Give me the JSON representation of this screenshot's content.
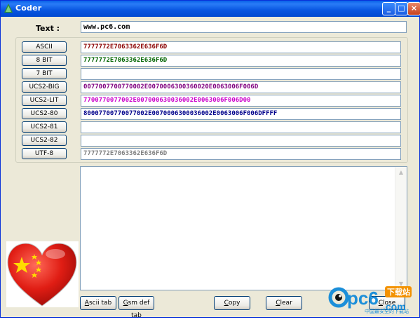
{
  "window": {
    "title": "Coder"
  },
  "text_label": "Text :",
  "text_value": "www.pc6.com",
  "rows": [
    {
      "label": "ASCII",
      "value": "7777772E7063362E636F6D",
      "color": "#8b0000"
    },
    {
      "label": "8 BIT",
      "value": "7777772E7063362E636F6D",
      "color": "#006400"
    },
    {
      "label": "7 BIT",
      "value": "",
      "color": "#000000"
    },
    {
      "label": "UCS2-BIG",
      "value": "0077007700770002E0070006300360020E0063006F006D",
      "color": "#800080"
    },
    {
      "label": "UCS2-LIT",
      "value": "7700770077002E007000630036002E0063006F006D00",
      "color": "#cc00cc"
    },
    {
      "label": "UCS2-80",
      "value": "80007700770077002E0070006300036002E0063006F006DFFFF",
      "color": "#00008b"
    },
    {
      "label": "UCS2-81",
      "value": "",
      "color": "#000000"
    },
    {
      "label": "UCS2-82",
      "value": "",
      "color": "#000000"
    },
    {
      "label": "UTF-8",
      "value": "7777772E7063362E636F6D",
      "color": "#808080"
    }
  ],
  "buttons": {
    "ascii_tab": "Ascii tab",
    "gsm_tab": "Gsm def tab",
    "copy": "Copy",
    "clear": "Clear",
    "close": "Close"
  },
  "watermark": {
    "brand": "pc6",
    "suffix": ".com",
    "badge": "下载站",
    "sub": "中国最安全的下载站"
  }
}
